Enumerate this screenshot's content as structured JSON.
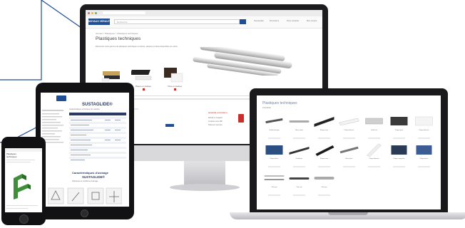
{
  "desktop": {
    "logo_text": "NOYAUX VERAUT",
    "search_placeholder": "Recherche",
    "header_links": [
      "Nouveautés",
      "Promotions",
      "Nous contacter",
      "Mon compte"
    ],
    "breadcrumb": "Accueil > Plastiques > Plastiques techniques",
    "page_title": "Plastiques techniques",
    "intro_text": "Découvrez notre gamme de plastiques techniques en barres, plaques et tubes disponibles sur stock.",
    "thumb_captions": [
      "Plastiques techniques",
      "Plaques en plastique",
      "Tubes en plastique"
    ],
    "footer_left_title": "Besoin d'aide ?",
    "footer_right_title": "Quantité et livraison",
    "footer_right_lines": [
      "Retrait en magasin",
      "Livraison sous 48h",
      "Paiement sécurisé"
    ],
    "colors": {
      "brand": "#1f4e94",
      "accent": "#c9302c"
    }
  },
  "tablet": {
    "title": "SUSTAGLIDE®",
    "subtitle": "Caractéristiques techniques du matériau",
    "section_title": "Caractéristiques d'usinage",
    "section_title_2": "SUSTAGLIDE®",
    "section_sub": "Tolérances et conditions d'usinage"
  },
  "phone": {
    "lines": [
      "Plastiques",
      "techniques"
    ]
  },
  "laptop": {
    "page_title": "Plastiques techniques",
    "subtitle": "13 produits",
    "product_captions": [
      "Profilé plastique",
      "Barre ronde",
      "Plaque noire",
      "Plaque blanche",
      "Profilé alu",
      "Plaque grise",
      "Plaque blanche",
      "Plaque bleue",
      "Profilé noir",
      "Plaque noire",
      "Barre plate",
      "Plaque blanche",
      "Plaque composite",
      "Plaque bleue",
      "Tube gris",
      "Tube noir",
      "Tube gris"
    ]
  }
}
